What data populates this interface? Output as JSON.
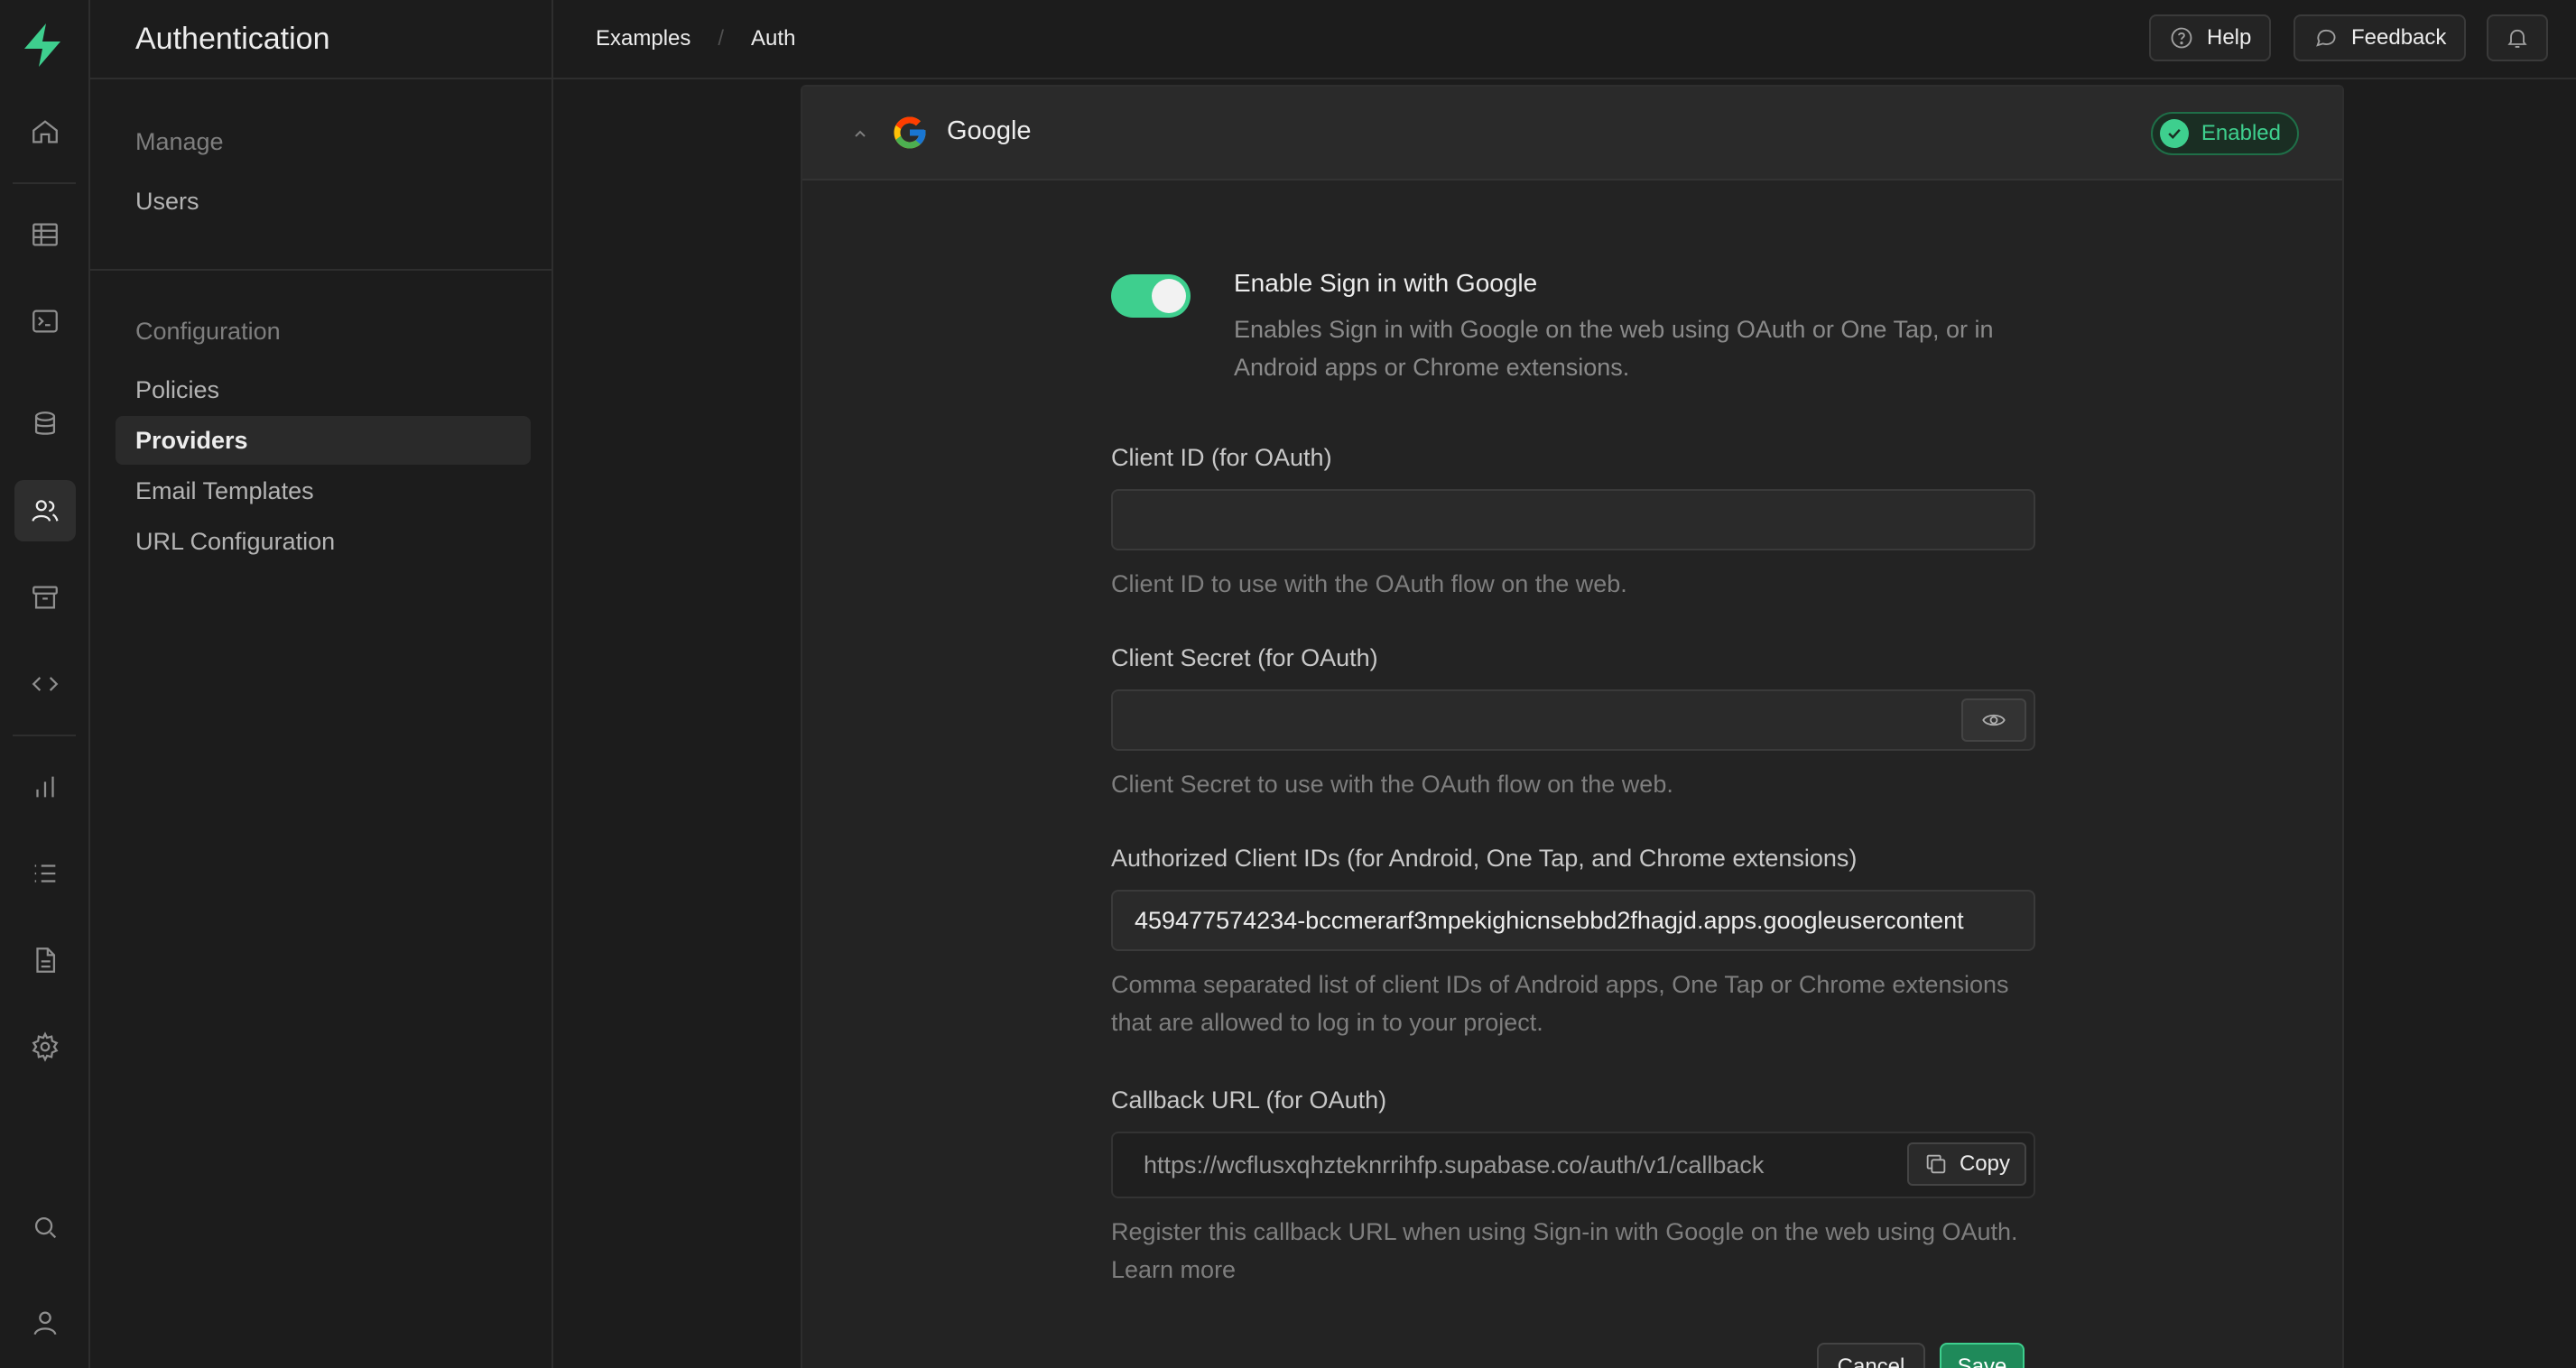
{
  "app": {
    "section_title": "Authentication",
    "accent": "#3ecf8e"
  },
  "rail": {
    "icons": [
      "home-icon",
      "table-editor-icon",
      "sql-editor-icon",
      "database-icon",
      "auth-users-icon",
      "storage-icon",
      "edge-functions-icon",
      "reports-icon",
      "logs-icon",
      "api-docs-icon",
      "settings-icon",
      "search-icon",
      "user-account-icon"
    ],
    "active": "auth-users-icon"
  },
  "menu": {
    "groups": [
      {
        "title": "Manage",
        "items": [
          "Users"
        ]
      },
      {
        "title": "Configuration",
        "items": [
          "Policies",
          "Providers",
          "Email Templates",
          "URL Configuration"
        ]
      }
    ],
    "active_item": "Providers"
  },
  "topbar": {
    "breadcrumbs": [
      "Examples",
      "Auth"
    ],
    "separator": "/",
    "help_label": "Help",
    "feedback_label": "Feedback"
  },
  "provider": {
    "name": "Google",
    "status": "Enabled",
    "toggle_label": "Enable Sign in with Google",
    "toggle_description": "Enables Sign in with Google on the web using OAuth or One Tap, or in Android apps or Chrome extensions.",
    "toggle_on": true,
    "client_id": {
      "label": "Client ID (for OAuth)",
      "value": "",
      "description": "Client ID to use with the OAuth flow on the web."
    },
    "client_secret": {
      "label": "Client Secret (for OAuth)",
      "value": "",
      "description": "Client Secret to use with the OAuth flow on the web."
    },
    "authorized_ids": {
      "label": "Authorized Client IDs (for Android, One Tap, and Chrome extensions)",
      "value": "459477574234-bccmerarf3mpekighicnsebbd2fhagjd.apps.googleusercontent",
      "description": "Comma separated list of client IDs of Android apps, One Tap or Chrome extensions that are allowed to log in to your project."
    },
    "callback": {
      "label": "Callback URL (for OAuth)",
      "value": "https://wcflusxqhzteknrrihfp.supabase.co/auth/v1/callback",
      "copy_label": "Copy",
      "description": "Register this callback URL when using Sign-in with Google on the web using OAuth. Learn more"
    },
    "cancel_label": "Cancel",
    "save_label": "Save"
  }
}
